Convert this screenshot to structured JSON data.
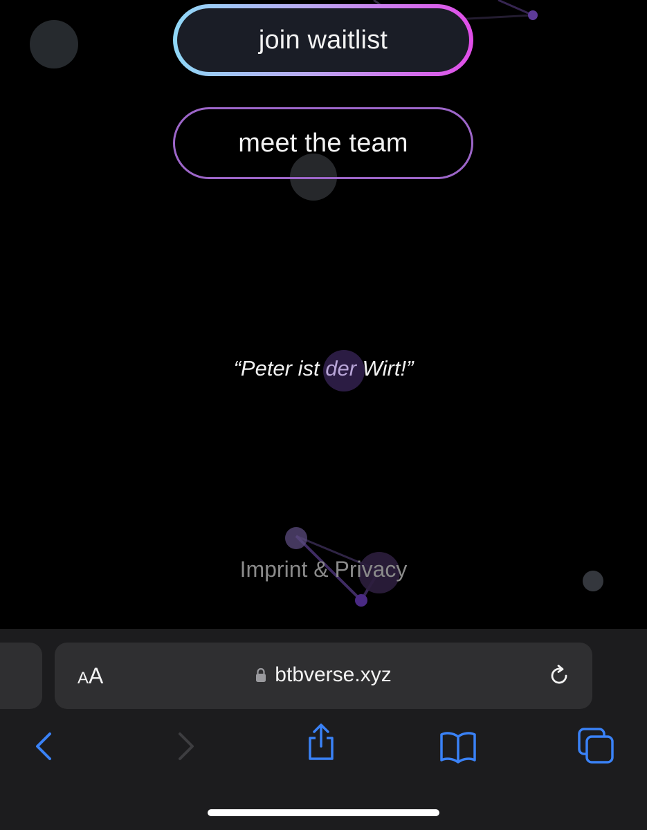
{
  "buttons": {
    "join_label": "join waitlist",
    "team_label": "meet the team"
  },
  "quote": {
    "open": "“Peter ist ",
    "highlight": "der",
    "close": " Wirt!”"
  },
  "footer": {
    "link_label": "Imprint & Privacy"
  },
  "browser": {
    "aa_small": "A",
    "aa_large": "A",
    "url": "btbverse.xyz",
    "icons": [
      "lock-icon",
      "reload-icon",
      "back-icon",
      "forward-icon",
      "share-icon",
      "bookmarks-icon",
      "tabs-icon"
    ]
  },
  "colors": {
    "background": "#000000",
    "join_gradient_start": "#8fd8f7",
    "join_gradient_end": "#e04de8",
    "team_border": "#9d66c9",
    "toolbar_accent": "#3a82f7",
    "chrome_bg": "#1c1c1e"
  }
}
